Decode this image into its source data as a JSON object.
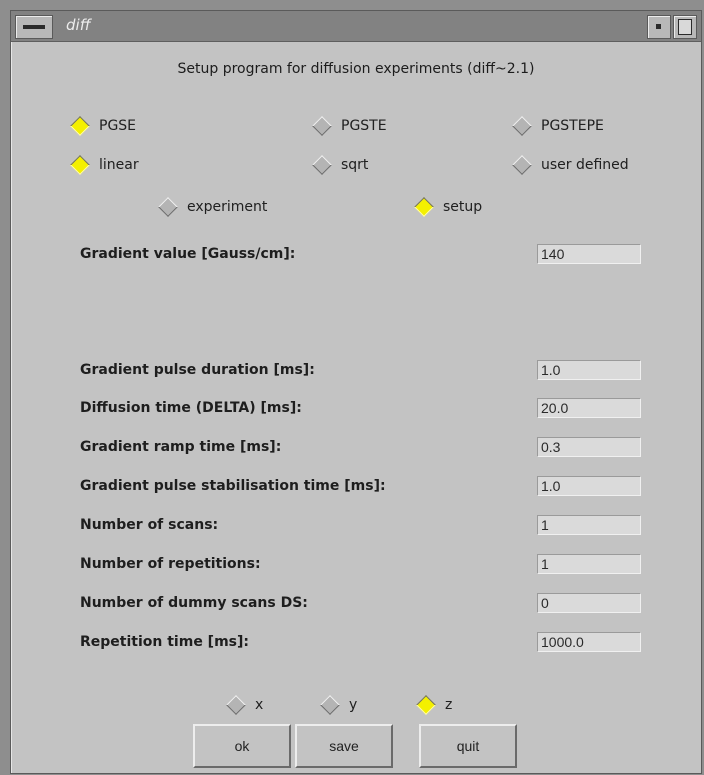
{
  "window": {
    "title": "diff"
  },
  "heading": "Setup program for diffusion experiments (diff~2.1)",
  "sequence_options": [
    {
      "label": "PGSE",
      "selected": true
    },
    {
      "label": "PGSTE",
      "selected": false
    },
    {
      "label": "PGSTEPE",
      "selected": false
    }
  ],
  "spacing_options": [
    {
      "label": "linear",
      "selected": true
    },
    {
      "label": "sqrt",
      "selected": false
    },
    {
      "label": "user defined",
      "selected": false
    }
  ],
  "mode_options": [
    {
      "label": "experiment",
      "selected": false
    },
    {
      "label": "setup",
      "selected": true
    }
  ],
  "params": {
    "gradient_value": {
      "label": "Gradient value [Gauss/cm]:",
      "value": "140"
    },
    "pulse_duration": {
      "label": "Gradient pulse duration [ms]:",
      "value": "1.0"
    },
    "diffusion_time": {
      "label": "Diffusion time (DELTA) [ms]:",
      "value": "20.0"
    },
    "ramp_time": {
      "label": "Gradient ramp time [ms]:",
      "value": "0.3"
    },
    "stabilisation_time": {
      "label": "Gradient pulse stabilisation time [ms]:",
      "value": "1.0"
    },
    "num_scans": {
      "label": "Number of scans:",
      "value": "1"
    },
    "num_repetitions": {
      "label": "Number of repetitions:",
      "value": "1"
    },
    "dummy_scans": {
      "label": "Number of dummy scans DS:",
      "value": "0"
    },
    "repetition_time": {
      "label": "Repetition time [ms]:",
      "value": "1000.0"
    }
  },
  "axis_options": [
    {
      "label": "x",
      "selected": false
    },
    {
      "label": "y",
      "selected": false
    },
    {
      "label": "z",
      "selected": true
    }
  ],
  "buttons": {
    "ok": "ok",
    "save": "save",
    "quit": "quit"
  },
  "colors": {
    "selected": "#f4f000",
    "panel": "#c3c3c3",
    "titlebar": "#828282"
  }
}
